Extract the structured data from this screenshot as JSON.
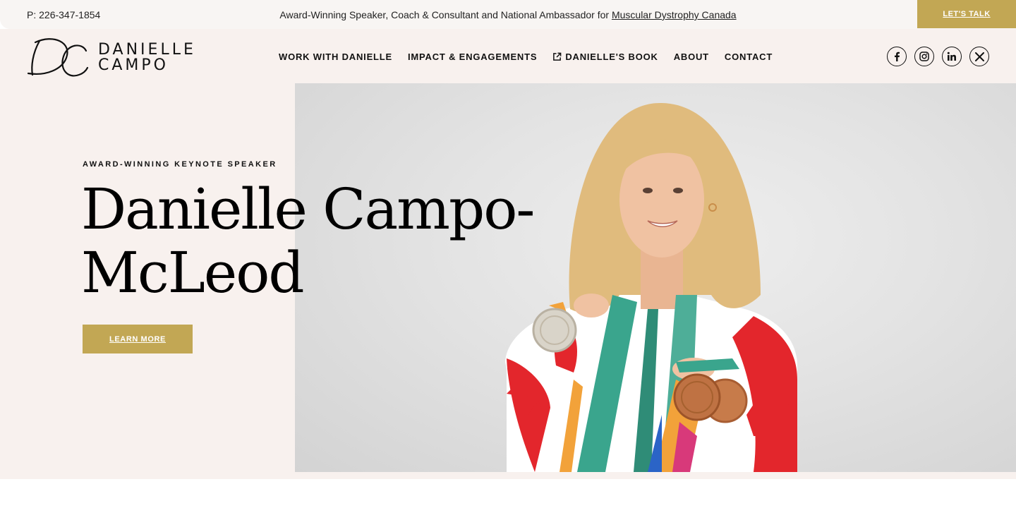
{
  "topbar": {
    "phone": "P: 226-347-1854",
    "announcement_text": "Award-Winning Speaker, Coach & Consultant and National Ambassador for ",
    "announcement_link": "Muscular Dystrophy Canada",
    "cta_label": "LET'S TALK"
  },
  "brand": {
    "monogram": "DC",
    "name_line1": "DANIELLE",
    "name_line2": "CAMPO"
  },
  "nav": {
    "items": [
      {
        "label": "WORK WITH DANIELLE"
      },
      {
        "label": "IMPACT & ENGAGEMENTS"
      },
      {
        "label": "DANIELLE'S BOOK",
        "icon": "external-link-icon"
      },
      {
        "label": "ABOUT"
      },
      {
        "label": "CONTACT"
      }
    ]
  },
  "socials": [
    {
      "icon": "facebook-icon",
      "glyph": "f"
    },
    {
      "icon": "instagram-icon",
      "glyph": ""
    },
    {
      "icon": "linkedin-icon",
      "glyph": "in"
    },
    {
      "icon": "x-icon",
      "glyph": "X"
    }
  ],
  "hero": {
    "eyebrow": "AWARD-WINNING KEYNOTE SPEAKER",
    "headline_line1": "Danielle Campo-",
    "headline_line2": "McLeod",
    "button_label": "LEARN MORE"
  },
  "colors": {
    "accent_gold": "#c2a754",
    "hero_background": "#f8f1ee",
    "topbar_background": "#f8f5f3"
  }
}
